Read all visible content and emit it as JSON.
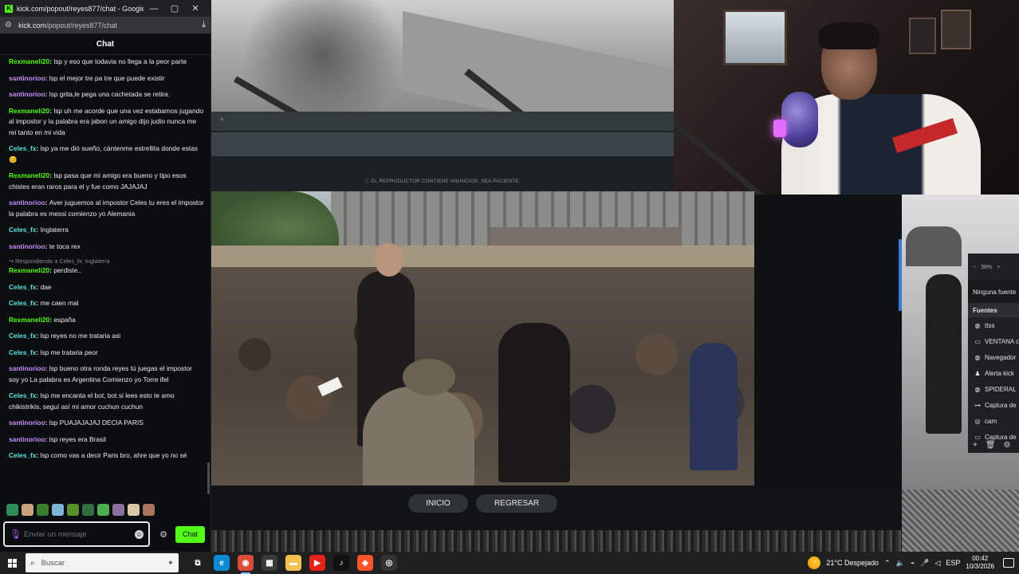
{
  "browser": {
    "tab_title": "kick.com/popout/reyes877/chat - Google...",
    "url_host": "kick.com",
    "url_path": "/popout/reyes877/chat"
  },
  "chat": {
    "header": "Chat",
    "messages": [
      {
        "user": "Rexmaneli20",
        "color": "#53fc18",
        "text": "lsp y eso que todavia no llega a la peor parte"
      },
      {
        "user": "santinorioo",
        "color": "#c98cff",
        "text": "lsp el mejor tre pa tre que puede existir"
      },
      {
        "user": "santinorioo",
        "color": "#c98cff",
        "text": "lsp grita,le pega una cachetada se retira."
      },
      {
        "user": "Rexmaneli20",
        "color": "#53fc18",
        "text": "lsp uh me acorde que una vez estabamos jugando al impostor y la palabra era jabon un amigo dijo judio nunca me rei tanto en mi vida"
      },
      {
        "user": "Celes_fx",
        "color": "#5ce0e6",
        "text": "lsp ya me dió sueño, cántenme estrellita donde estas 😊"
      },
      {
        "user": "Rexmaneli20",
        "color": "#53fc18",
        "text": "lsp pasa que mi amigo era bueno y tipo esos chistes eran raros para el y fue como JAJAJAJ"
      },
      {
        "user": "santinorioo",
        "color": "#c98cff",
        "text": "Aver juguemos al impostor Celes tu eres el impostor la palabra es messi comienzo yo Alemania"
      },
      {
        "user": "Celes_fx",
        "color": "#5ce0e6",
        "text": "Inglaterra"
      },
      {
        "user": "santinorioo",
        "color": "#c98cff",
        "text": "te toca rex"
      },
      {
        "reply_to": "↪ Respondiendo a Celes_fx: Inglaterra",
        "user": "Rexmaneli20",
        "color": "#53fc18",
        "text": "perdiste.."
      },
      {
        "user": "Celes_fx",
        "color": "#5ce0e6",
        "text": "dae"
      },
      {
        "user": "Celes_fx",
        "color": "#5ce0e6",
        "text": "me caen mal"
      },
      {
        "user": "Rexmaneli20",
        "color": "#53fc18",
        "text": "españa"
      },
      {
        "user": "Celes_fx",
        "color": "#5ce0e6",
        "text": "lsp reyes no me trataria asi"
      },
      {
        "user": "Celes_fx",
        "color": "#5ce0e6",
        "text": "lsp me trataria peor"
      },
      {
        "user": "santinorioo",
        "color": "#c98cff",
        "text": "lsp bueno otra ronda reyes tú juegas el impostor soy yo La palabra es Argentina Comienzo yo Torre ifel"
      },
      {
        "user": "Celes_fx",
        "color": "#5ce0e6",
        "text": "lsp me encanta el bot, bot si lees esto te amo chikistrikis, seguí así mi amor cuchun cuchun"
      },
      {
        "user": "santinorioo",
        "color": "#c98cff",
        "text": "lsp PUAJAJAJAJ DECIA PARIS"
      },
      {
        "user": "santinorioo",
        "color": "#c98cff",
        "text": "lsp reyes era Brasil"
      },
      {
        "user": "Celes_fx",
        "color": "#5ce0e6",
        "text": "lsp como vas a decir Paris bro, ahre que yo no sé"
      }
    ],
    "emotes": [
      "#2e8b57",
      "#c9a27a",
      "#3a7d2e",
      "#7fb3d5",
      "#5a8f2e",
      "#2f6f3f",
      "#4caf50",
      "#8b6f9e",
      "#d8c8a8",
      "#a9745b"
    ],
    "input_placeholder": "Enviar un mensaje",
    "send_label": "Chat"
  },
  "player": {
    "ad_notice": "ⓘ EL REPRODUCTOR CONTIENE ANUNCIOS. SEA PACIENTE."
  },
  "controls": {
    "inicio": "INICIO",
    "regresar": "REGRESAR"
  },
  "obs": {
    "zoom": "38%",
    "no_source": "Ninguna fuente",
    "sources_header": "Fuentes",
    "sources": [
      {
        "icon": "globe-icon",
        "glyph": "◍",
        "label": "ttss"
      },
      {
        "icon": "window-icon",
        "glyph": "▭",
        "label": "VENTANA c"
      },
      {
        "icon": "browser-icon",
        "glyph": "◍",
        "label": "Navegador"
      },
      {
        "icon": "person-icon",
        "glyph": "♟",
        "label": "Alerta kick"
      },
      {
        "icon": "globe-icon",
        "glyph": "◍",
        "label": "SPIDERAL"
      },
      {
        "icon": "capture-icon",
        "glyph": "⊶",
        "label": "Captura de"
      },
      {
        "icon": "camera-icon",
        "glyph": "◎",
        "label": "cam"
      },
      {
        "icon": "capture-icon",
        "glyph": "▭",
        "label": "Captura de"
      }
    ]
  },
  "taskbar": {
    "search_placeholder": "Buscar",
    "apps": [
      {
        "name": "task-view",
        "glyph": "⧉",
        "bg": "transparent"
      },
      {
        "name": "edge",
        "glyph": "e",
        "bg": "#0c8ad6"
      },
      {
        "name": "chrome",
        "glyph": "◉",
        "bg": "#dd4b39"
      },
      {
        "name": "calculator",
        "glyph": "▦",
        "bg": "#3a3a3a"
      },
      {
        "name": "file-explorer",
        "glyph": "▬",
        "bg": "#f2c14e"
      },
      {
        "name": "youtube",
        "glyph": "▶",
        "bg": "#e62117"
      },
      {
        "name": "tiktok",
        "glyph": "♪",
        "bg": "#111111"
      },
      {
        "name": "brave",
        "glyph": "◆",
        "bg": "#fb542b"
      },
      {
        "name": "obs",
        "glyph": "◎",
        "bg": "#333333"
      }
    ],
    "weather": "21°C  Despejado",
    "language": "ESP",
    "time": "00:42",
    "date": "10/3/2026"
  }
}
